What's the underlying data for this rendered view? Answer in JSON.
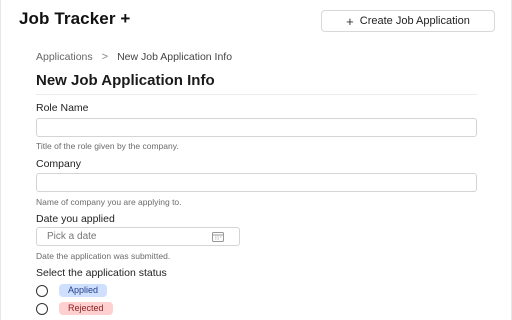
{
  "header": {
    "app_title": "Job Tracker +",
    "create_button_label": "Create Job Application",
    "create_button_icon": "plus-icon"
  },
  "breadcrumb": {
    "items": [
      "Applications",
      "New Job Application Info"
    ],
    "separator": ">"
  },
  "form": {
    "title": "New Job Application Info",
    "role": {
      "label": "Role Name",
      "value": "",
      "help": "Title of the role given by the company."
    },
    "company": {
      "label": "Company",
      "value": "",
      "help": "Name of company you are applying to."
    },
    "date": {
      "label": "Date you applied",
      "placeholder": "Pick a date",
      "icon": "calendar-icon",
      "help": "Date the application was submitted."
    },
    "status": {
      "label": "Select the application status",
      "options": [
        {
          "label": "Applied",
          "color": "#cfe0ff",
          "text_color": "#1f3f8a",
          "selected": false
        },
        {
          "label": "Rejected",
          "color": "#ffd0d0",
          "text_color": "#8a1f1f",
          "selected": false
        }
      ]
    }
  }
}
